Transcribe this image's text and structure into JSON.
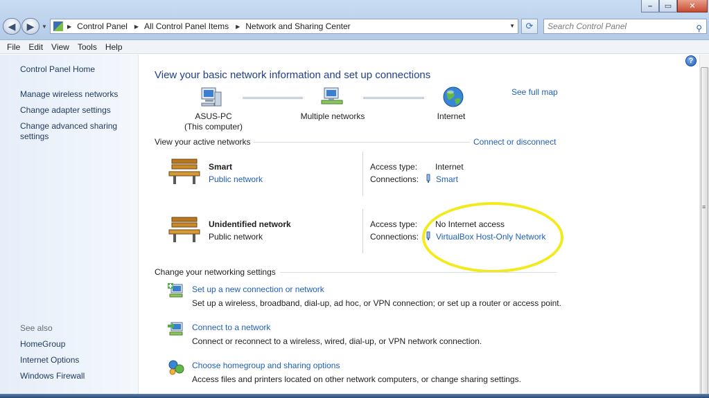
{
  "window": {
    "minimize": "–",
    "maximize": "▭",
    "close": "✕"
  },
  "address": {
    "crumbs": [
      "Control Panel",
      "All Control Panel Items",
      "Network and Sharing Center"
    ]
  },
  "search": {
    "placeholder": "Search Control Panel"
  },
  "menu": [
    "File",
    "Edit",
    "View",
    "Tools",
    "Help"
  ],
  "leftnav": {
    "home": "Control Panel Home",
    "links": [
      "Manage wireless networks",
      "Change adapter settings",
      "Change advanced sharing settings"
    ],
    "see_also": "See also",
    "see_also_links": [
      "HomeGroup",
      "Internet Options",
      "Windows Firewall"
    ]
  },
  "main": {
    "title": "View your basic network information and set up connections",
    "see_full_map": "See full map",
    "map": {
      "computer_name": "ASUS-PC",
      "computer_sub": "(This computer)",
      "middle": "Multiple networks",
      "internet": "Internet"
    },
    "active_title": "View your active networks",
    "connect_disconnect": "Connect or disconnect",
    "networks": [
      {
        "name": "Smart",
        "type": "Public network",
        "type_is_link": true,
        "access_label": "Access type:",
        "access": "Internet",
        "conn_label": "Connections:",
        "connection": "Smart"
      },
      {
        "name": "Unidentified network",
        "type": "Public network",
        "type_is_link": false,
        "access_label": "Access type:",
        "access": "No Internet access",
        "conn_label": "Connections:",
        "connection": "VirtualBox Host-Only Network"
      }
    ],
    "change_title": "Change your networking settings",
    "tasks": [
      {
        "link": "Set up a new connection or network",
        "desc": "Set up a wireless, broadband, dial-up, ad hoc, or VPN connection; or set up a router or access point."
      },
      {
        "link": "Connect to a network",
        "desc": "Connect or reconnect to a wireless, wired, dial-up, or VPN network connection."
      },
      {
        "link": "Choose homegroup and sharing options",
        "desc": "Access files and printers located on other network computers, or change sharing settings."
      }
    ]
  },
  "icons": {
    "help": "help-icon",
    "search": "search-icon",
    "back": "back-arrow-icon",
    "forward": "forward-arrow-icon",
    "refresh": "refresh-icon",
    "computer": "computer-icon",
    "networks": "multiple-networks-icon",
    "globe": "globe-icon",
    "bench": "public-network-bench-icon"
  },
  "colors": {
    "link": "#1f5fb8",
    "heading": "#1e3f8a",
    "highlight": "#f2ea1a"
  }
}
